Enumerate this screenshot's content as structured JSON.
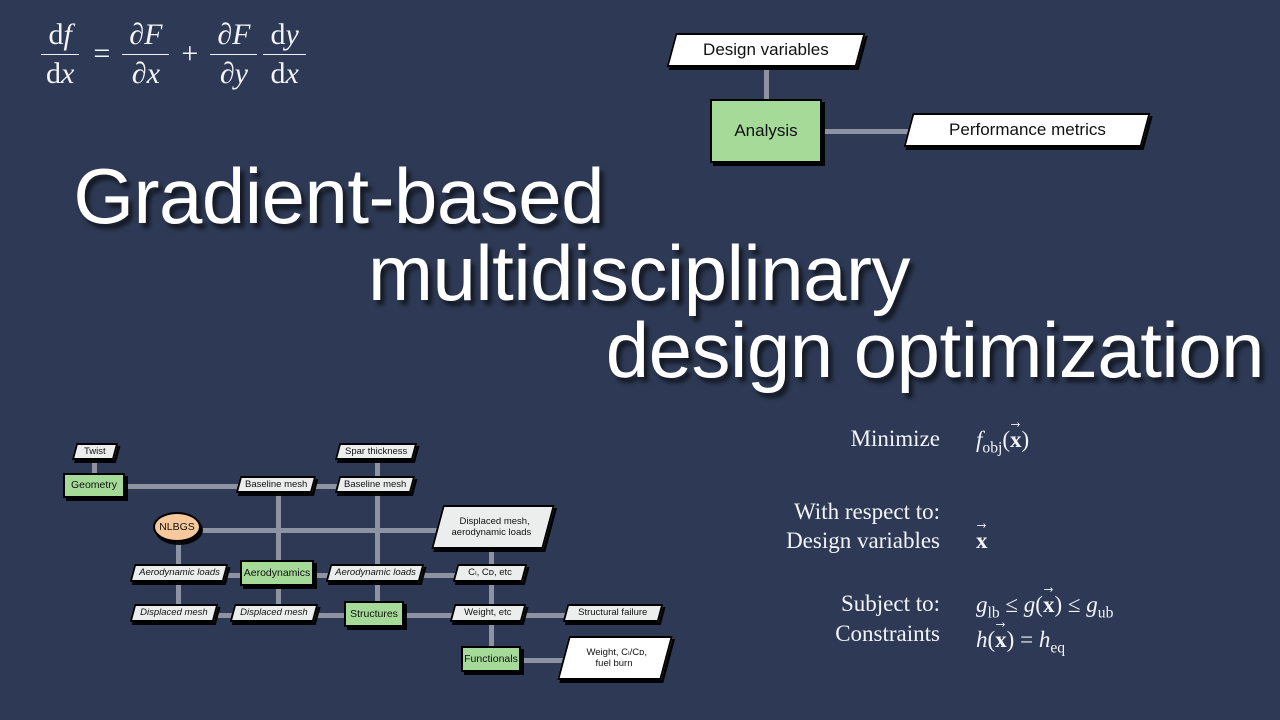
{
  "background_color": "#2e3a55",
  "accent_colors": {
    "discipline_green": "#a5da99",
    "driver_orange": "#f6c89c",
    "data_gray": "#eceded",
    "data_white": "#ffffff",
    "connector_gray": "#8d93a3",
    "text_white": "#ffffff"
  },
  "equation": {
    "lhs": {
      "num_d": "d",
      "num_var": "f",
      "den_d": "d",
      "den_var": "x"
    },
    "eq_sign": "=",
    "term1": {
      "num_partial": "∂",
      "num_var": "F",
      "den_partial": "∂",
      "den_var": "x"
    },
    "plus_sign": "+",
    "term2": {
      "num_partial": "∂",
      "num_var": "F",
      "den_partial": "∂",
      "den_var": "y"
    },
    "term3": {
      "num_d": "d",
      "num_var": "y",
      "den_d": "d",
      "den_var": "x"
    }
  },
  "title": {
    "line1": "Gradient-based",
    "line2": "multidisciplinary",
    "line3": "design optimization"
  },
  "mini_xdsm": {
    "nodes": [
      {
        "id": "design-variables",
        "label": "Design variables",
        "shape": "parallelogram",
        "fill": "white"
      },
      {
        "id": "analysis",
        "label": "Analysis",
        "shape": "rectangle",
        "fill": "green"
      },
      {
        "id": "performance-metrics",
        "label": "Performance metrics",
        "shape": "parallelogram",
        "fill": "white"
      }
    ]
  },
  "full_xdsm": {
    "nodes": [
      {
        "id": "twist",
        "label": "Twist",
        "shape": "parallelogram",
        "fill": "gray"
      },
      {
        "id": "spar-thickness",
        "label": "Spar thickness",
        "shape": "parallelogram",
        "fill": "gray"
      },
      {
        "id": "geometry",
        "label": "Geometry",
        "shape": "rectangle",
        "fill": "green"
      },
      {
        "id": "baseline-mesh-1",
        "label": "Baseline mesh",
        "shape": "parallelogram",
        "fill": "gray"
      },
      {
        "id": "baseline-mesh-2",
        "label": "Baseline mesh",
        "shape": "parallelogram",
        "fill": "gray"
      },
      {
        "id": "nlbgs",
        "label": "NLBGS",
        "shape": "ellipse",
        "fill": "orange"
      },
      {
        "id": "displaced-mesh-aero-loads",
        "label_line1": "Displaced mesh,",
        "label_line2": "aerodynamic loads",
        "shape": "parallelogram",
        "fill": "gray"
      },
      {
        "id": "aerodynamic-loads-1",
        "label": "Aerodynamic loads",
        "shape": "parallelogram",
        "fill": "gray"
      },
      {
        "id": "aerodynamics",
        "label": "Aerodynamics",
        "shape": "rectangle",
        "fill": "green"
      },
      {
        "id": "aerodynamic-loads-2",
        "label": "Aerodynamic loads",
        "shape": "parallelogram",
        "fill": "gray"
      },
      {
        "id": "cl-cd-etc",
        "label": "Cₗ, Cᴅ, etc",
        "shape": "parallelogram",
        "fill": "gray"
      },
      {
        "id": "displaced-mesh-1",
        "label": "Displaced mesh",
        "shape": "parallelogram",
        "fill": "gray"
      },
      {
        "id": "displaced-mesh-2",
        "label": "Displaced mesh",
        "shape": "parallelogram",
        "fill": "gray"
      },
      {
        "id": "structures",
        "label": "Structures",
        "shape": "rectangle",
        "fill": "green"
      },
      {
        "id": "weight-etc",
        "label": "Weight, etc",
        "shape": "parallelogram",
        "fill": "gray"
      },
      {
        "id": "structural-failure",
        "label": "Structural failure",
        "shape": "parallelogram",
        "fill": "gray"
      },
      {
        "id": "functionals",
        "label": "Functionals",
        "shape": "rectangle",
        "fill": "green"
      },
      {
        "id": "weight-clcd-fuelburn",
        "label_line1": "Weight, Cₗ/Cᴅ,",
        "label_line2": "fuel burn",
        "shape": "parallelogram",
        "fill": "white"
      }
    ]
  },
  "optimization": {
    "minimize_label": "Minimize",
    "minimize_expr": {
      "f": "f",
      "sub": "obj",
      "arg": "x"
    },
    "wrt_label": "With respect to:\nDesign variables",
    "wrt_expr": {
      "arg": "x"
    },
    "subject_label": "Subject to:\nConstraints",
    "constraint_1": {
      "g": "g",
      "lb": "lb",
      "le1": "≤",
      "gx": "g",
      "arg": "x",
      "le2": "≤",
      "ub": "ub"
    },
    "constraint_2": {
      "h": "h",
      "arg": "x",
      "eq": "=",
      "heq": "eq"
    }
  }
}
